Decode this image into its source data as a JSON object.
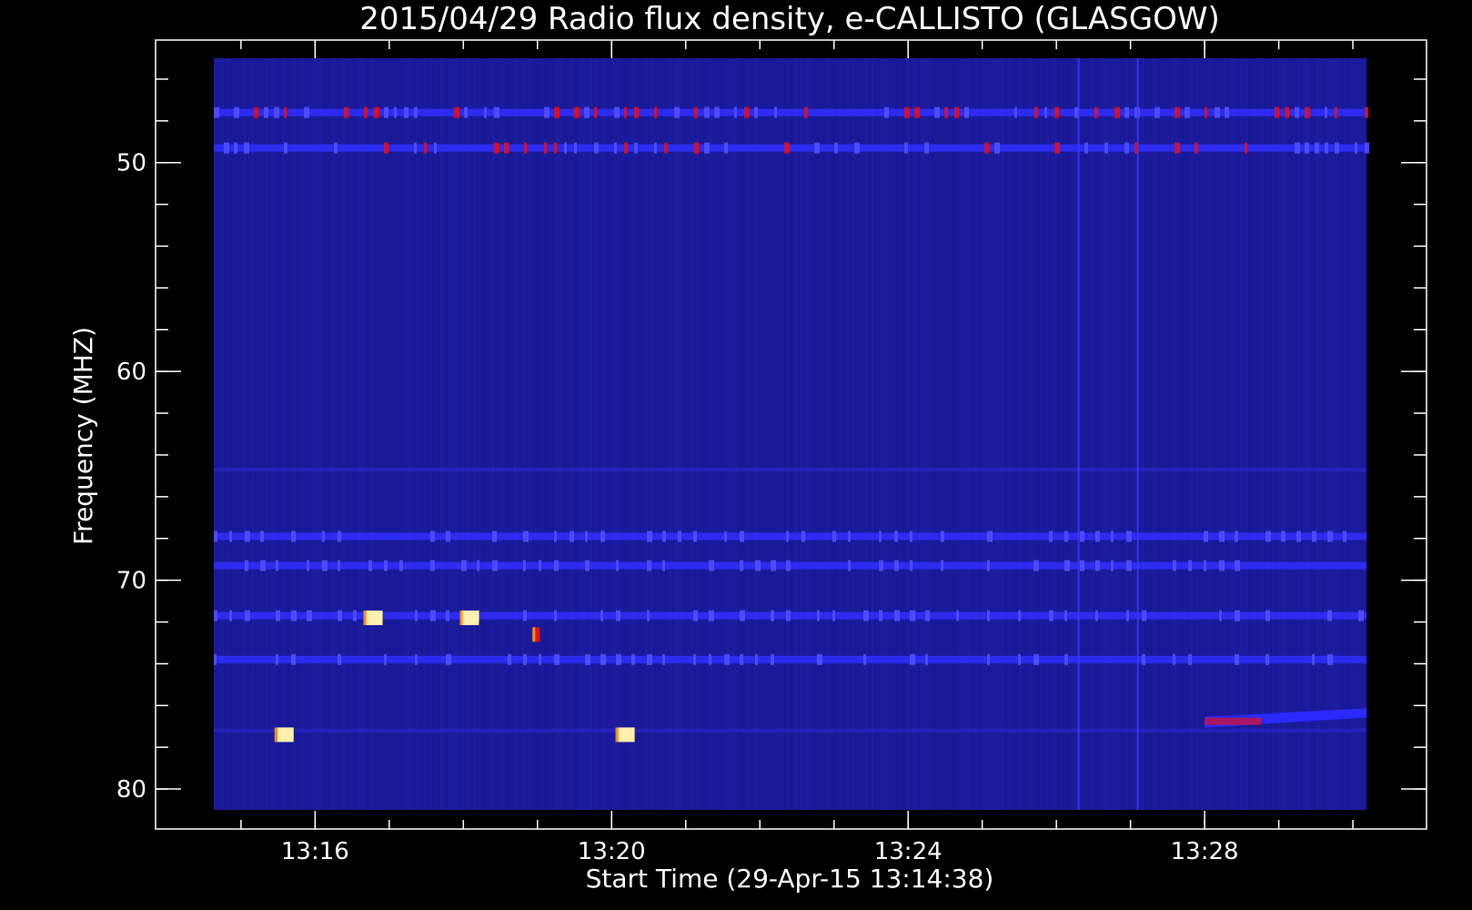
{
  "chart_data": {
    "type": "heatmap",
    "title": "2015/04/29  Radio flux density, e-CALLISTO (GLASGOW)",
    "xlabel": "Start Time (29-Apr-15 13:14:38)",
    "ylabel": "Frequency (MHZ)",
    "x_axis": {
      "unit": "minutes",
      "range": [
        "13:14:38",
        "13:30:11"
      ],
      "major_ticks": [
        "13:16",
        "13:20",
        "13:24",
        "13:28"
      ],
      "minor_tick_step_minutes": 1
    },
    "y_axis": {
      "inverted": true,
      "range": [
        45,
        81
      ],
      "data_range": [
        45,
        81
      ],
      "major_ticks": [
        50,
        60,
        70,
        80
      ],
      "minor_tick_step": 2
    },
    "colormap": {
      "low": "#1a1a9a",
      "mid": "#3030ff",
      "high": "#e01020",
      "peak": "#fff0b0"
    },
    "features": [
      {
        "kind": "band",
        "freq": 47.6,
        "intensity": "high-intermittent"
      },
      {
        "kind": "band",
        "freq": 49.3,
        "intensity": "high-intermittent"
      },
      {
        "kind": "band",
        "freq": 64.7,
        "intensity": "weak"
      },
      {
        "kind": "band",
        "freq": 67.9,
        "intensity": "medium"
      },
      {
        "kind": "band",
        "freq": 69.3,
        "intensity": "medium"
      },
      {
        "kind": "band",
        "freq": 71.7,
        "intensity": "medium"
      },
      {
        "kind": "band",
        "freq": 73.8,
        "intensity": "medium"
      },
      {
        "kind": "band",
        "freq": 77.2,
        "intensity": "weak"
      },
      {
        "kind": "burst",
        "time": "13:15:36",
        "freq": 77.4,
        "level": "peak"
      },
      {
        "kind": "burst",
        "time": "13:20:12",
        "freq": 77.4,
        "level": "peak"
      },
      {
        "kind": "burst",
        "time": "13:16:48",
        "freq": 71.8,
        "level": "peak"
      },
      {
        "kind": "burst",
        "time": "13:18:06",
        "freq": 71.8,
        "level": "peak"
      },
      {
        "kind": "burst",
        "time": "13:19:00",
        "freq": 72.6,
        "level": "high"
      },
      {
        "kind": "streak",
        "time_start": "13:28:00",
        "time_end": "13:30:11",
        "freq_start": 76.8,
        "freq_end": 76.4,
        "level": "high"
      },
      {
        "kind": "vertical-line",
        "time": "13:26:18",
        "level": "medium"
      },
      {
        "kind": "vertical-line",
        "time": "13:27:06",
        "level": "medium"
      }
    ]
  }
}
